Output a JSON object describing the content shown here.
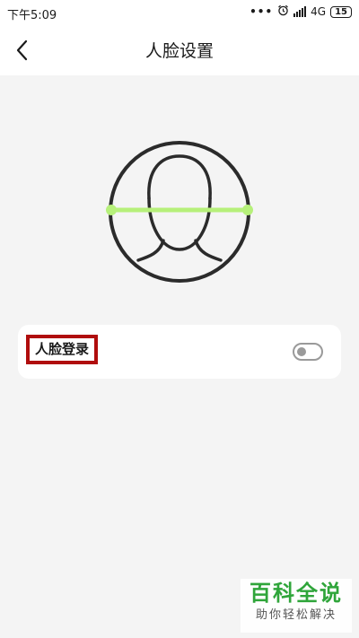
{
  "status_bar": {
    "time": "下午5:09",
    "network": "4G",
    "battery": "15",
    "icons": [
      "more-dots-icon",
      "alarm-icon",
      "signal-icon",
      "battery-icon"
    ]
  },
  "header": {
    "title": "人脸设置",
    "back_icon": "chevron-left-icon"
  },
  "illustration": {
    "icon": "face-scan-icon",
    "scan_line_color": "#b6f07a"
  },
  "settings": {
    "face_login_label": "人脸登录",
    "face_login_enabled": false
  },
  "colors": {
    "highlight_border": "#b00d0d",
    "background": "#f4f4f4"
  },
  "watermark": {
    "title": "百科全说",
    "subtitle": "助你轻松解决"
  }
}
